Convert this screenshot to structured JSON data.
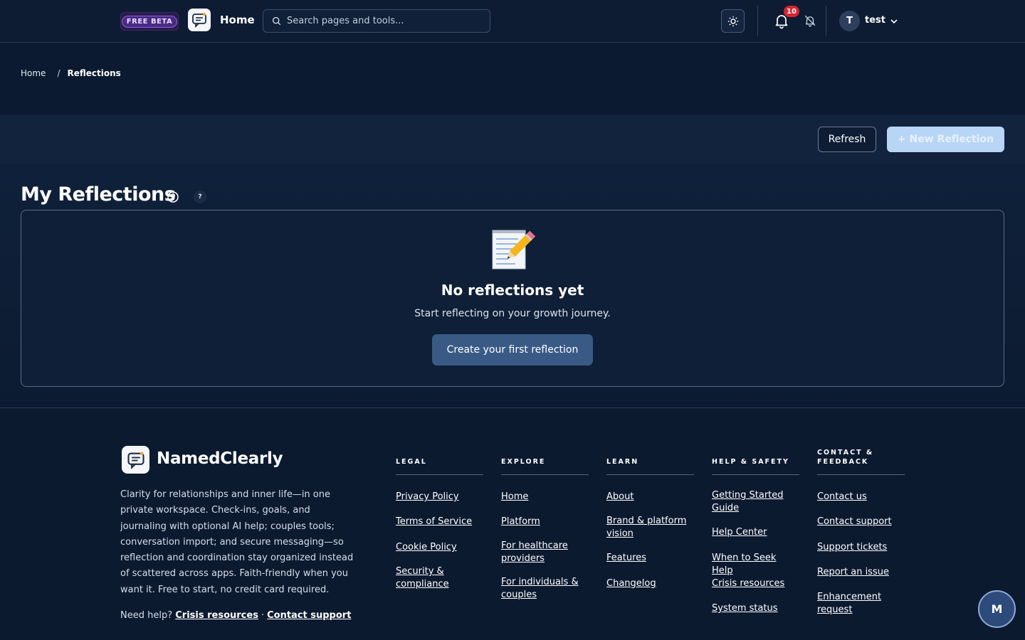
{
  "header": {
    "beta_label": "FREE BETA",
    "home_label": "Home",
    "search_placeholder": "Search pages and tools...",
    "notification_count": "10",
    "user_initial": "T",
    "username": "test"
  },
  "breadcrumb": {
    "home": "Home",
    "separator": "/",
    "current": "Reflections"
  },
  "toolbar": {
    "refresh_label": "Refresh",
    "new_label": "+ New Reflection"
  },
  "page": {
    "title": "My Reflections",
    "help_badge": "?"
  },
  "empty_state": {
    "title": "No reflections yet",
    "subtitle": "Start reflecting on your growth journey.",
    "cta_label": "Create your first reflection"
  },
  "footer": {
    "brand": "NamedClearly",
    "description": "Clarity for relationships and inner life—in one private workspace. Check-ins, goals, and journaling with optional AI help; couples tools; conversation import; and secure messaging—so reflection and coordination stay organized instead of scattered across apps. Faith-friendly when you want it. Free to start, no credit card required.",
    "help_prefix": "Need help?",
    "help_crisis": "Crisis resources",
    "help_dot": "·",
    "help_contact": "Contact support",
    "columns": [
      {
        "heading": "LEGAL",
        "links": [
          "Privacy Policy",
          "Terms of Service",
          "Cookie Policy",
          "Security & compliance"
        ]
      },
      {
        "heading": "EXPLORE",
        "links": [
          "Home",
          "Platform",
          "For healthcare providers",
          "For individuals & couples"
        ]
      },
      {
        "heading": "LEARN",
        "links": [
          "About",
          "Brand & platform vision",
          "Features",
          "Changelog"
        ]
      },
      {
        "heading": "HELP & SAFETY",
        "links": [
          "Getting Started Guide",
          "Help Center",
          "When to Seek Help",
          "Crisis resources",
          "System status"
        ]
      },
      {
        "heading": "CONTACT & FEEDBACK",
        "links": [
          "Contact us",
          "Contact support",
          "Support tickets",
          "Report an issue",
          "Enhancement request"
        ]
      }
    ]
  },
  "chat_fab_label": "M",
  "colors": {
    "background": "#0b1a30",
    "accent_button": "#3a5a86",
    "primary_disabled": "#b9d5f5",
    "badge_red": "#d9232e",
    "beta_purple": "#4b2a86"
  }
}
